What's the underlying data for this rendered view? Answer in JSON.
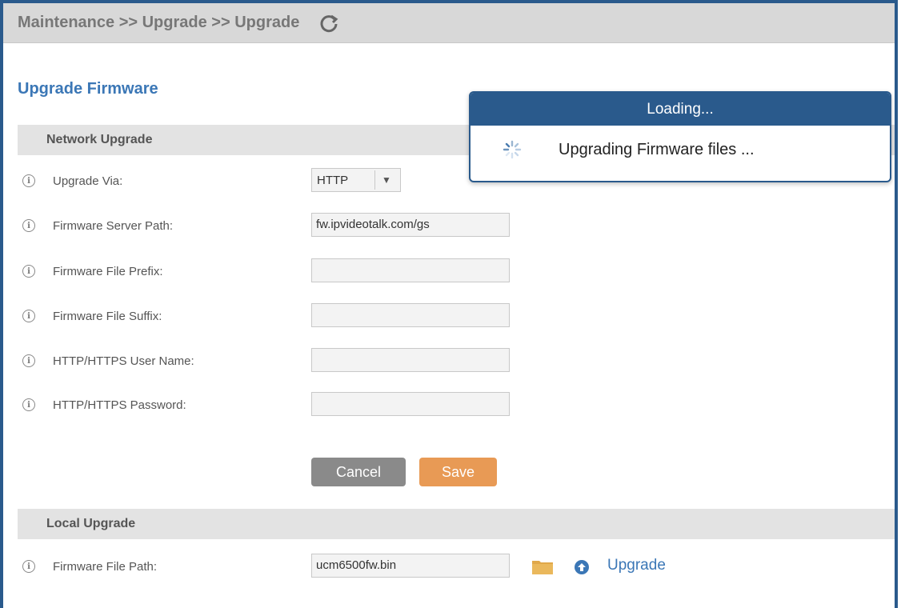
{
  "breadcrumb": "Maintenance >> Upgrade >> Upgrade",
  "page_title": "Upgrade Firmware",
  "network_section": "Network Upgrade",
  "fields": {
    "upgrade_via": {
      "label": "Upgrade Via:",
      "value": "HTTP"
    },
    "server_path": {
      "label": "Firmware Server Path:",
      "value": "fw.ipvideotalk.com/gs"
    },
    "file_prefix": {
      "label": "Firmware File Prefix:",
      "value": ""
    },
    "file_suffix": {
      "label": "Firmware File Suffix:",
      "value": ""
    },
    "user_name": {
      "label": "HTTP/HTTPS User Name:",
      "value": ""
    },
    "password": {
      "label": "HTTP/HTTPS Password:",
      "value": ""
    }
  },
  "buttons": {
    "cancel": "Cancel",
    "save": "Save"
  },
  "local_section": "Local Upgrade",
  "local": {
    "label": "Firmware File Path:",
    "value": "ucm6500fw.bin",
    "upgrade_label": "Upgrade"
  },
  "modal": {
    "title": "Loading...",
    "message": "Upgrading Firmware files ..."
  },
  "colors": {
    "accent": "#3b77b6",
    "modal_header": "#2a5a8c",
    "save": "#e89a55",
    "cancel": "#8a8a8a"
  }
}
